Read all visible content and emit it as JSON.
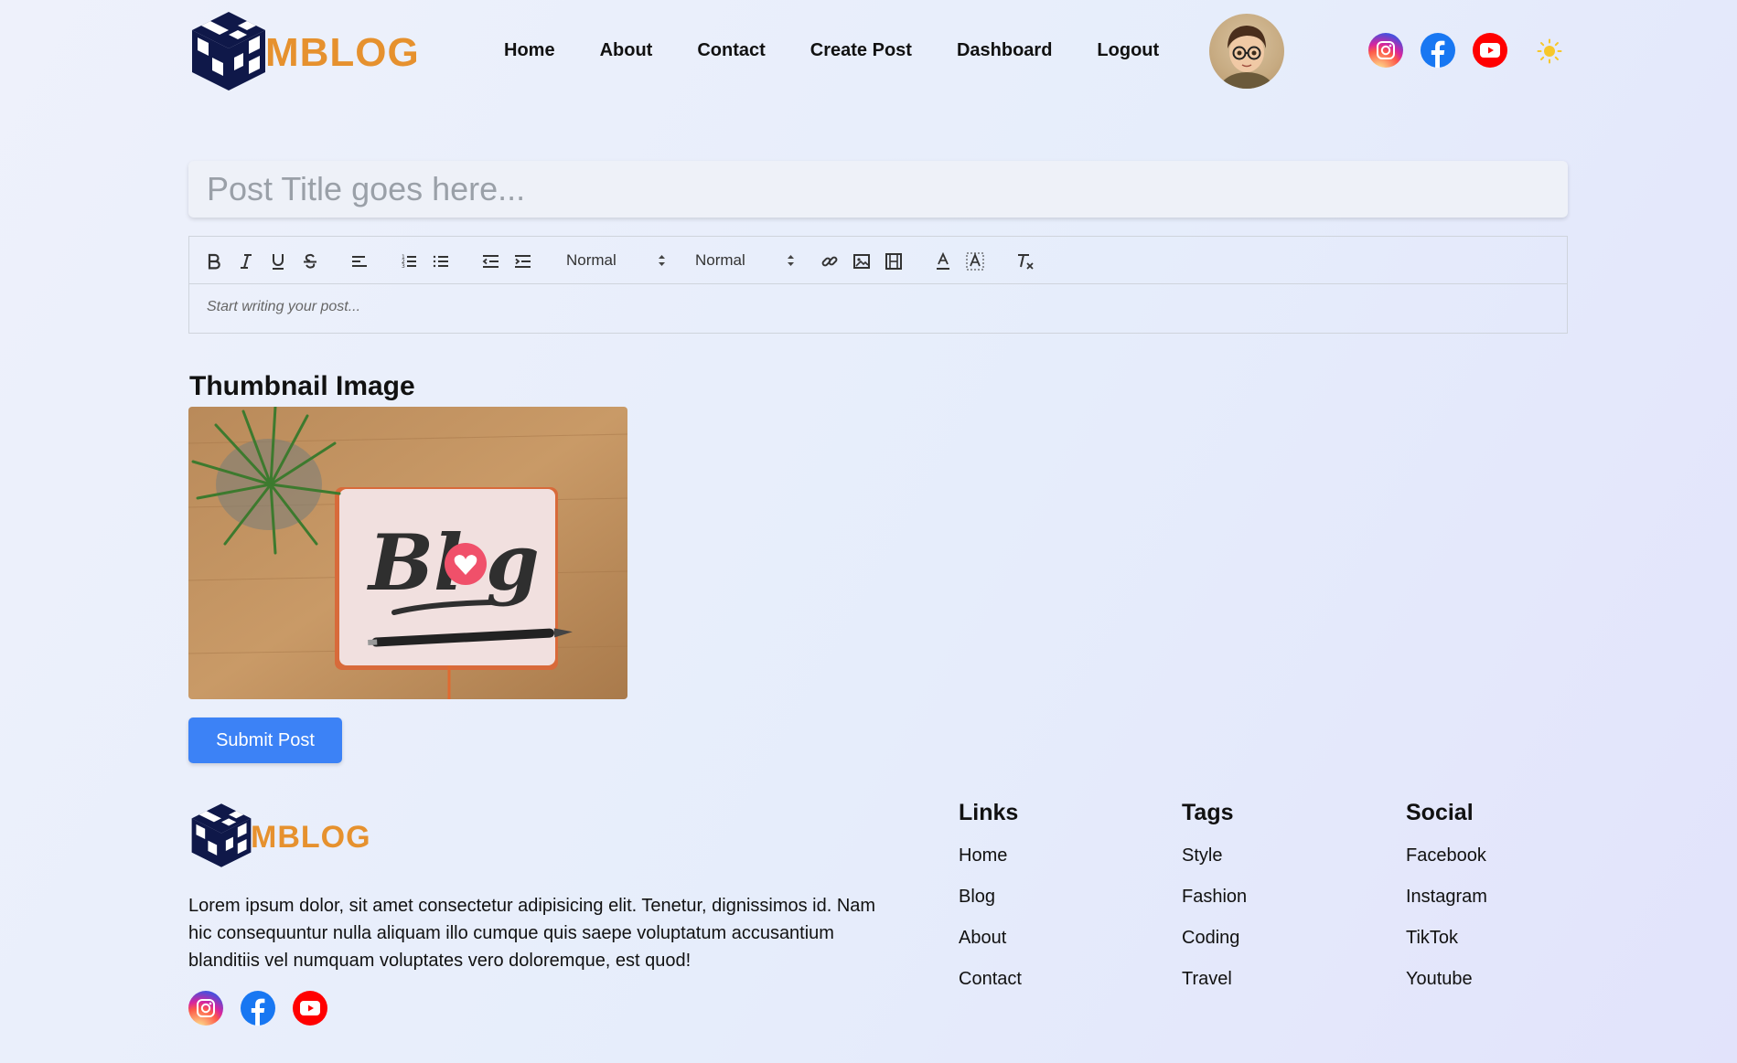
{
  "brand": {
    "logo_text": "MBLOG"
  },
  "nav": {
    "items": [
      "Home",
      "About",
      "Contact",
      "Create Post",
      "Dashboard",
      "Logout"
    ]
  },
  "header": {
    "social_icons": [
      "instagram-icon",
      "facebook-icon",
      "youtube-icon"
    ],
    "theme_toggle_icon": "sun-icon"
  },
  "post": {
    "title_placeholder": "Post Title goes here...",
    "editor": {
      "placeholder": "Start writing your post...",
      "header_select": "Normal",
      "size_select": "Normal",
      "toolbar_icons": [
        "bold-icon",
        "italic-icon",
        "underline-icon",
        "strike-icon",
        "align-icon",
        "ordered-list-icon",
        "bullet-list-icon",
        "outdent-icon",
        "indent-icon",
        "link-icon",
        "image-icon",
        "video-icon",
        "text-color-icon",
        "background-color-icon",
        "clear-format-icon"
      ]
    },
    "thumbnail_heading": "Thumbnail Image",
    "submit_label": "Submit Post"
  },
  "footer": {
    "logo_text": "MBLOG",
    "description": "Lorem ipsum dolor, sit amet consectetur adipisicing elit. Tenetur, dignissimos id. Nam hic consequuntur nulla aliquam illo cumque quis saepe voluptatum accusantium blanditiis vel numquam voluptates vero doloremque, est quod!",
    "columns": [
      {
        "title": "Links",
        "items": [
          "Home",
          "Blog",
          "About",
          "Contact"
        ]
      },
      {
        "title": "Tags",
        "items": [
          "Style",
          "Fashion",
          "Coding",
          "Travel"
        ]
      },
      {
        "title": "Social",
        "items": [
          "Facebook",
          "Instagram",
          "TikTok",
          "Youtube"
        ]
      }
    ]
  },
  "colors": {
    "brand_orange": "#e6912e",
    "brand_navy": "#0f1849",
    "submit_blue": "#3c82f6",
    "facebook_blue": "#1877f2",
    "youtube_red": "#ff0000"
  }
}
